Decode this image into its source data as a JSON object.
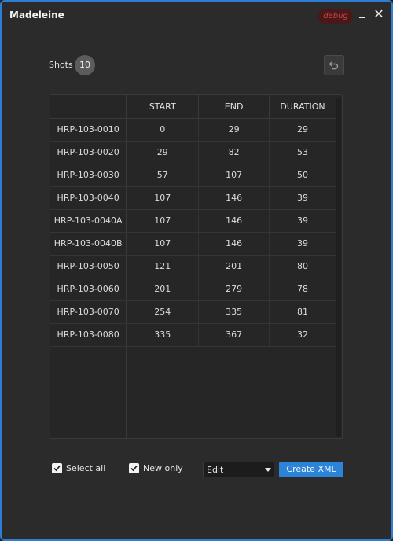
{
  "window": {
    "title": "Madeleine",
    "debug_badge": "debug"
  },
  "icons": {
    "minimize": "minimize-icon",
    "close": "close-icon",
    "undo": "undo-icon",
    "check": "check-icon",
    "dropdown": "chevron-down-icon"
  },
  "colors": {
    "accent": "#2b84d8",
    "debug_badge_bg": "#4a1818",
    "debug_badge_text": "#c24545",
    "window_bg": "#2b2b2b"
  },
  "shots": {
    "label": "Shots",
    "count": "10"
  },
  "table": {
    "columns": [
      "START",
      "END",
      "DURATION"
    ],
    "rows": [
      {
        "name": "HRP-103-0010",
        "start": "0",
        "end": "29",
        "duration": "29"
      },
      {
        "name": "HRP-103-0020",
        "start": "29",
        "end": "82",
        "duration": "53"
      },
      {
        "name": "HRP-103-0030",
        "start": "57",
        "end": "107",
        "duration": "50"
      },
      {
        "name": "HRP-103-0040",
        "start": "107",
        "end": "146",
        "duration": "39"
      },
      {
        "name": "HRP-103-0040A",
        "start": "107",
        "end": "146",
        "duration": "39"
      },
      {
        "name": "HRP-103-0040B",
        "start": "107",
        "end": "146",
        "duration": "39"
      },
      {
        "name": "HRP-103-0050",
        "start": "121",
        "end": "201",
        "duration": "80"
      },
      {
        "name": "HRP-103-0060",
        "start": "201",
        "end": "279",
        "duration": "78"
      },
      {
        "name": "HRP-103-0070",
        "start": "254",
        "end": "335",
        "duration": "81"
      },
      {
        "name": "HRP-103-0080",
        "start": "335",
        "end": "367",
        "duration": "32"
      }
    ]
  },
  "footer": {
    "select_all": {
      "label": "Select all",
      "checked": true
    },
    "new_only": {
      "label": "New only",
      "checked": true
    },
    "mode": {
      "value": "Edit"
    },
    "create_button": "Create XML"
  }
}
